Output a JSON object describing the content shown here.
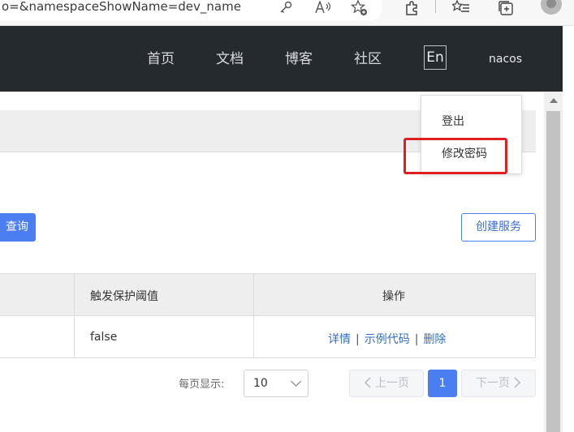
{
  "browser": {
    "url_fragment": "o=&namespaceShowName=dev_name",
    "icons": [
      "key-icon",
      "read-aloud-icon",
      "add-favorite-icon",
      "extensions-icon",
      "favorites-icon",
      "collections-icon",
      "profile-icon"
    ]
  },
  "header": {
    "nav": [
      "首页",
      "文档",
      "博客",
      "社区"
    ],
    "lang": "En",
    "user": "nacos"
  },
  "dropdown": {
    "items": [
      "登出",
      "修改密码"
    ]
  },
  "toolbar": {
    "query_label": "查询",
    "create_label": "创建服务"
  },
  "table": {
    "headers": [
      "触发保护阈值",
      "操作"
    ],
    "rows": [
      {
        "threshold": "false",
        "actions": [
          "详情",
          "示例代码",
          "删除"
        ]
      }
    ]
  },
  "pagination": {
    "page_size_label": "每页显示:",
    "page_size": "10",
    "prev": "上一页",
    "current": "1",
    "next": "下一页"
  },
  "colors": {
    "header_bg": "#252a2f",
    "primary": "#4a7ef1",
    "link": "#2f6fc7",
    "highlight": "#e02020"
  }
}
